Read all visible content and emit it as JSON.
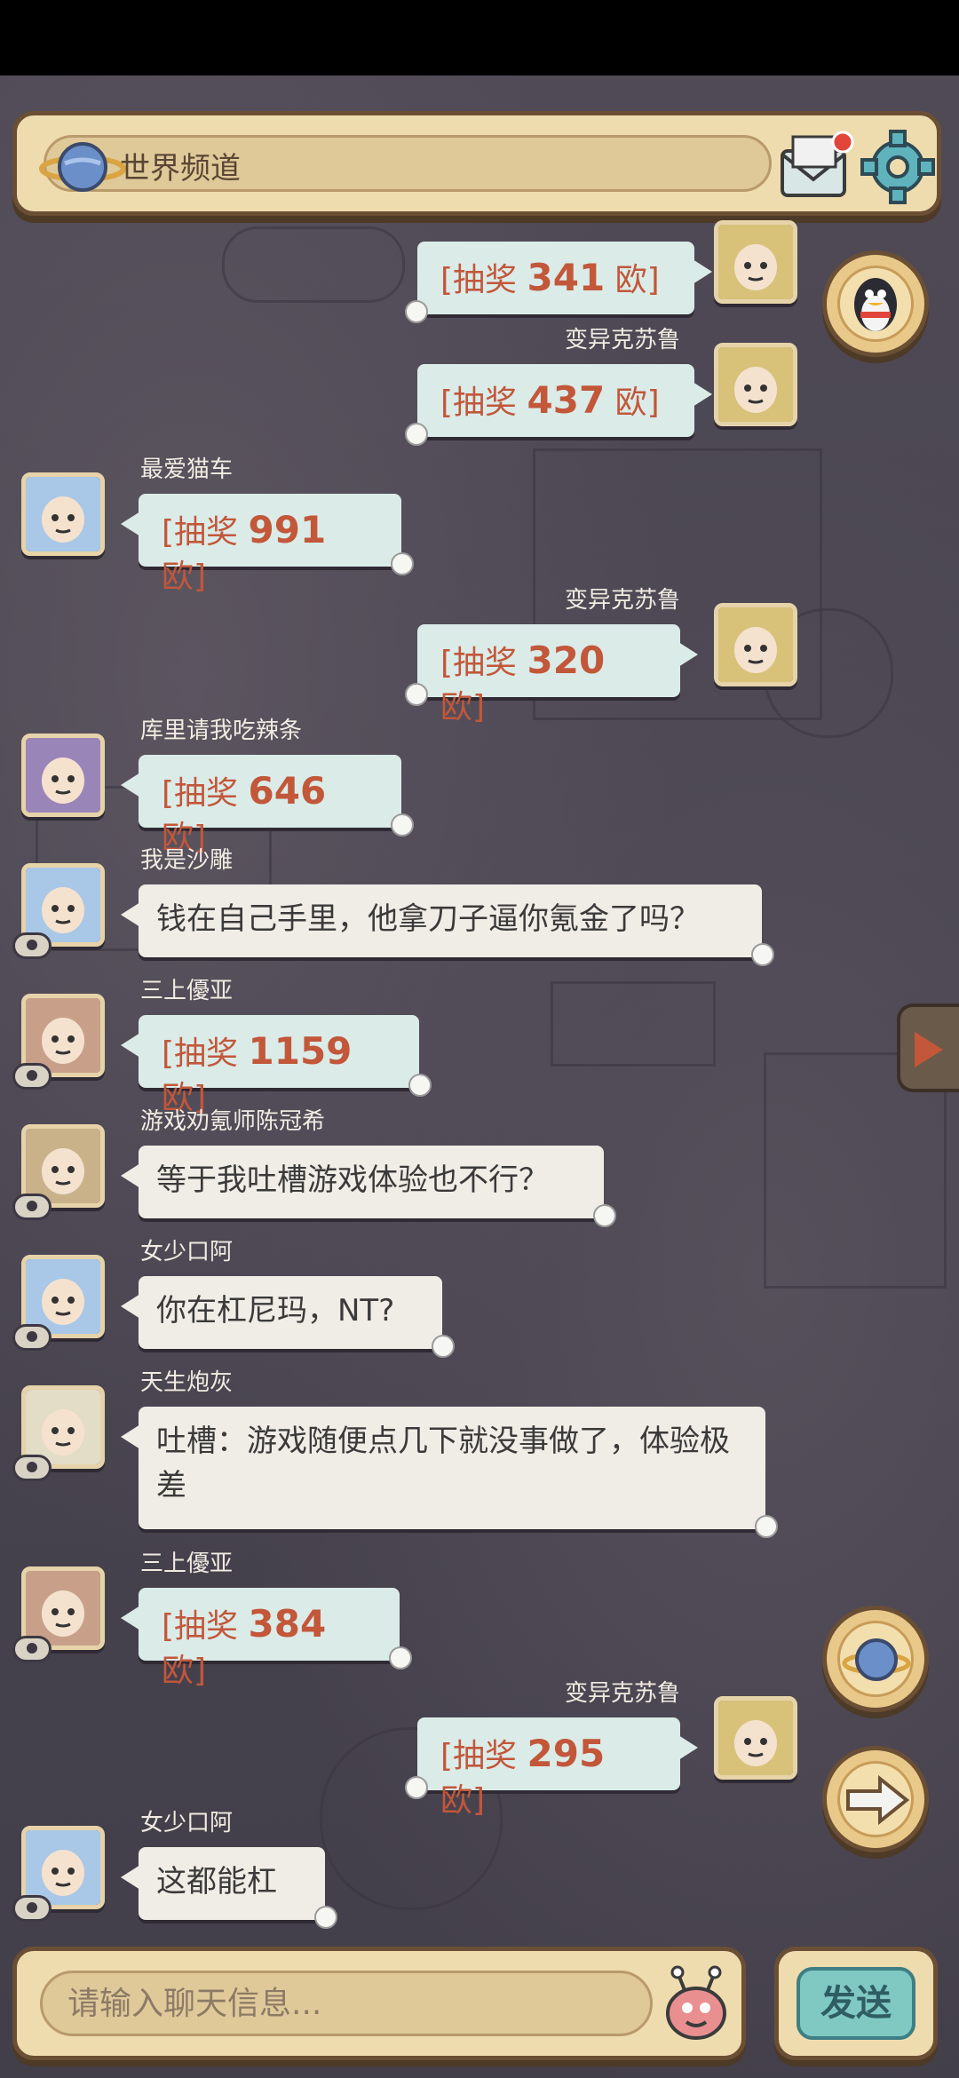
{
  "header": {
    "channel_title": "世界频道"
  },
  "input": {
    "placeholder": "请输入聊天信息..."
  },
  "send": {
    "label": "发送"
  },
  "lottery_word": "抽奖",
  "currency": "欧",
  "messages": [
    {
      "side": "right",
      "sender": "",
      "type": "lottery",
      "amount": "341"
    },
    {
      "side": "right",
      "sender": "变异克苏鲁",
      "type": "lottery",
      "amount": "437"
    },
    {
      "side": "left",
      "sender": "最爱猫车",
      "type": "lottery",
      "amount": "991"
    },
    {
      "side": "right",
      "sender": "变异克苏鲁",
      "type": "lottery",
      "amount": "320"
    },
    {
      "side": "left",
      "sender": "库里请我吃辣条",
      "type": "lottery",
      "amount": "646"
    },
    {
      "side": "left",
      "sender": "我是沙雕",
      "type": "text",
      "text": "钱在自己手里，他拿刀子逼你氪金了吗？"
    },
    {
      "side": "left",
      "sender": "三上優亚",
      "type": "lottery",
      "amount": "1159"
    },
    {
      "side": "left",
      "sender": "游戏劝氪师陈冠希",
      "type": "text",
      "text": "等于我吐槽游戏体验也不行？"
    },
    {
      "side": "left",
      "sender": "女少口阿",
      "type": "text",
      "text": "你在杠尼玛，NT?"
    },
    {
      "side": "left",
      "sender": "天生炮灰",
      "type": "text",
      "text": "吐槽：游戏随便点几下就没事做了，体验极差"
    },
    {
      "side": "left",
      "sender": "三上優亚",
      "type": "lottery",
      "amount": "384"
    },
    {
      "side": "right",
      "sender": "变异克苏鲁",
      "type": "lottery",
      "amount": "295"
    },
    {
      "side": "left",
      "sender": "女少口阿",
      "type": "text",
      "text": "这都能杠"
    }
  ],
  "colors": {
    "bubble_lottery": "#dbebe8",
    "bubble_text": "#f0ede6",
    "lottery_text": "#c2573a",
    "frame": "#6b4f34",
    "panel": "#efdcae"
  },
  "icons": [
    "planet-icon",
    "mail-icon",
    "gear-icon",
    "qq-penguin-icon",
    "planet-icon",
    "arrow-right-icon",
    "emoji-icon",
    "eye-icon"
  ]
}
